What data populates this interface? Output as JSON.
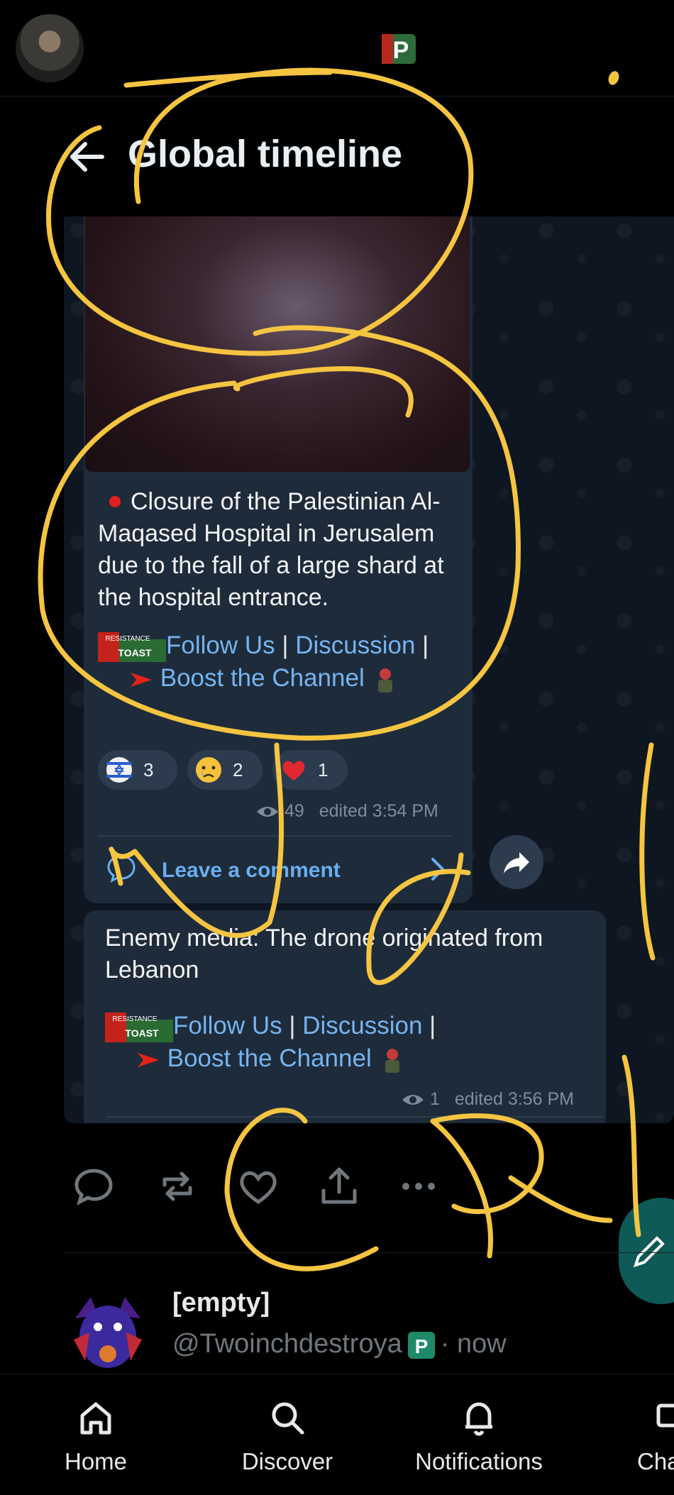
{
  "header": {
    "title": "Global timeline"
  },
  "post": {
    "text": "Closure of the Palestinian Al-Maqased Hospital in Jerusalem due to the fall of a large shard at the hospital entrance.",
    "follow_label": "Follow Us",
    "separator": "|",
    "discussion_label": "Discussion",
    "boost_label": "Boost the Channel",
    "reactions": [
      {
        "icon": "israel-flag-icon",
        "count": "3"
      },
      {
        "icon": "crying-face-icon",
        "count": "2"
      },
      {
        "icon": "heart-icon",
        "count": "1"
      }
    ],
    "views": "49",
    "edited": "edited 3:54 PM",
    "comment_label": "Leave a comment"
  },
  "post2": {
    "text": "Enemy media: The drone originated from Lebanon",
    "follow_label": "Follow Us",
    "separator": "|",
    "discussion_label": "Discussion",
    "boost_label": "Boost the Channel",
    "views": "1",
    "edited": "edited 3:56 PM"
  },
  "logo_text": {
    "resistance": "RESISTANCE",
    "toast": "TOAST"
  },
  "next_item": {
    "name": "[empty]",
    "handle": "@Twoinchdestroya",
    "time": "· now"
  },
  "nav": {
    "items": [
      {
        "label": "Home",
        "icon": "home-icon"
      },
      {
        "label": "Discover",
        "icon": "search-icon"
      },
      {
        "label": "Notifications",
        "icon": "bell-icon"
      },
      {
        "label": "Cha",
        "icon": "chat-icon"
      }
    ]
  },
  "colors": {
    "link": "#76b4f0",
    "bubble": "#1e2b3a",
    "scribble": "#f5c542"
  }
}
